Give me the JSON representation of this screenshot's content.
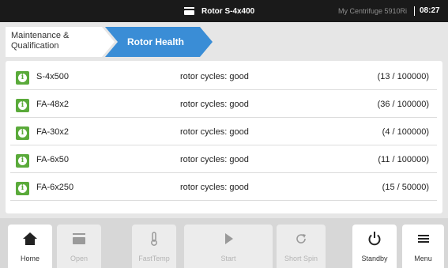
{
  "status_bar": {
    "rotor": "Rotor S-4x400",
    "device": "My Centrifuge 5910Ri",
    "time": "08:27"
  },
  "breadcrumb": {
    "items": [
      "Maintenance & Qualification",
      "Rotor Health"
    ]
  },
  "rotors": [
    {
      "name": "S-4x500",
      "status": "rotor cycles: good",
      "cycles": "(13 / 100000)"
    },
    {
      "name": "FA-48x2",
      "status": "rotor cycles: good",
      "cycles": "(36 / 100000)"
    },
    {
      "name": "FA-30x2",
      "status": "rotor cycles: good",
      "cycles": "(4 / 100000)"
    },
    {
      "name": "FA-6x50",
      "status": "rotor cycles: good",
      "cycles": "(11 / 100000)"
    },
    {
      "name": "FA-6x250",
      "status": "rotor cycles: good",
      "cycles": "(15 / 50000)"
    }
  ],
  "badge_icon": "info-icon",
  "badge_glyph": "i",
  "colors": {
    "accent_blue": "#3a8dd6",
    "status_green": "#5aaa3a",
    "status_bar": "#1a1a1a"
  },
  "toolbar": {
    "home": "Home",
    "open": "Open",
    "fasttemp": "FastTemp",
    "start": "Start",
    "short_spin": "Short Spin",
    "standby": "Standby",
    "menu": "Menu"
  }
}
